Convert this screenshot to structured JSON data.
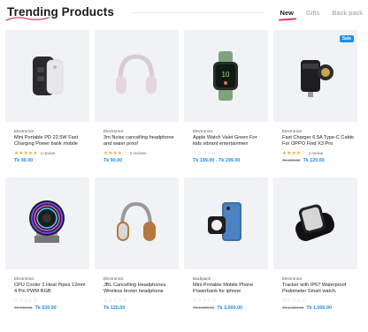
{
  "header": {
    "title": "Trending Products",
    "tabs": [
      "New",
      "Gifts",
      "Back pack"
    ],
    "active_tab": "New"
  },
  "colors": {
    "accent": "#1f8ce6",
    "star": "#f5a623",
    "underline": "#d93f6a"
  },
  "products": [
    {
      "category": "Electronics",
      "name": "Mini Portable PD 22.5W Fast Charging Power bank mobile",
      "stars": 5,
      "review_text": "1 review",
      "old_price": "",
      "price": "Tk 90.00",
      "badge": "",
      "icon": "power-bank"
    },
    {
      "category": "Electronics",
      "name": "3m Noise cancelling headphone and water proof",
      "stars": 4,
      "review_text": "2 reviews",
      "old_price": "",
      "price": "Tk 90.00",
      "badge": "",
      "icon": "headphones"
    },
    {
      "category": "Electronics",
      "name": "Apple Watch Valet Green For kids vibrant entertainmen",
      "stars": 0,
      "review_text": "",
      "old_price": "",
      "price": "Tk 199.00 - Tk 299.00",
      "badge": "",
      "icon": "smartwatch"
    },
    {
      "category": "Electronics",
      "name": "Fast Charger 6.5A Type-C Cable For OPPO Find X3 Pro",
      "stars": 4,
      "review_text": "1 review",
      "old_price": "Tk 500.00",
      "price": "Tk 120.00",
      "badge": "Sale",
      "icon": "car-charger"
    },
    {
      "category": "Electronics",
      "name": "CPU Cooler 2 Heat Pipes 12mm 4 Pin PWM RGB",
      "stars": 0,
      "review_text": "",
      "old_price": "Tk 900.00",
      "price": "Tk 520.00",
      "badge": "",
      "icon": "cpu-cooler"
    },
    {
      "category": "Electronics",
      "name": "JBL Cancelling Headphones Wireless brown headphone",
      "stars": 0,
      "review_text": "",
      "old_price": "",
      "price": "Tk 125.00",
      "badge": "",
      "icon": "headphones-brown"
    },
    {
      "category": "Backpack",
      "name": "Mini Portable Mobile Phone Powerbank for iphone",
      "stars": 0,
      "review_text": "",
      "old_price": "Tk 2,000.00",
      "price": "Tk 3,000.00",
      "badge": "",
      "icon": "phone-powerbank"
    },
    {
      "category": "Electronics",
      "name": "Tracker with IP67 Waterproof Pedometer Smart watch.",
      "stars": 0,
      "review_text": "",
      "old_price": "Tk 1,500.00",
      "price": "Tk 1,000.00",
      "badge": "",
      "icon": "black-smartwatch"
    }
  ]
}
